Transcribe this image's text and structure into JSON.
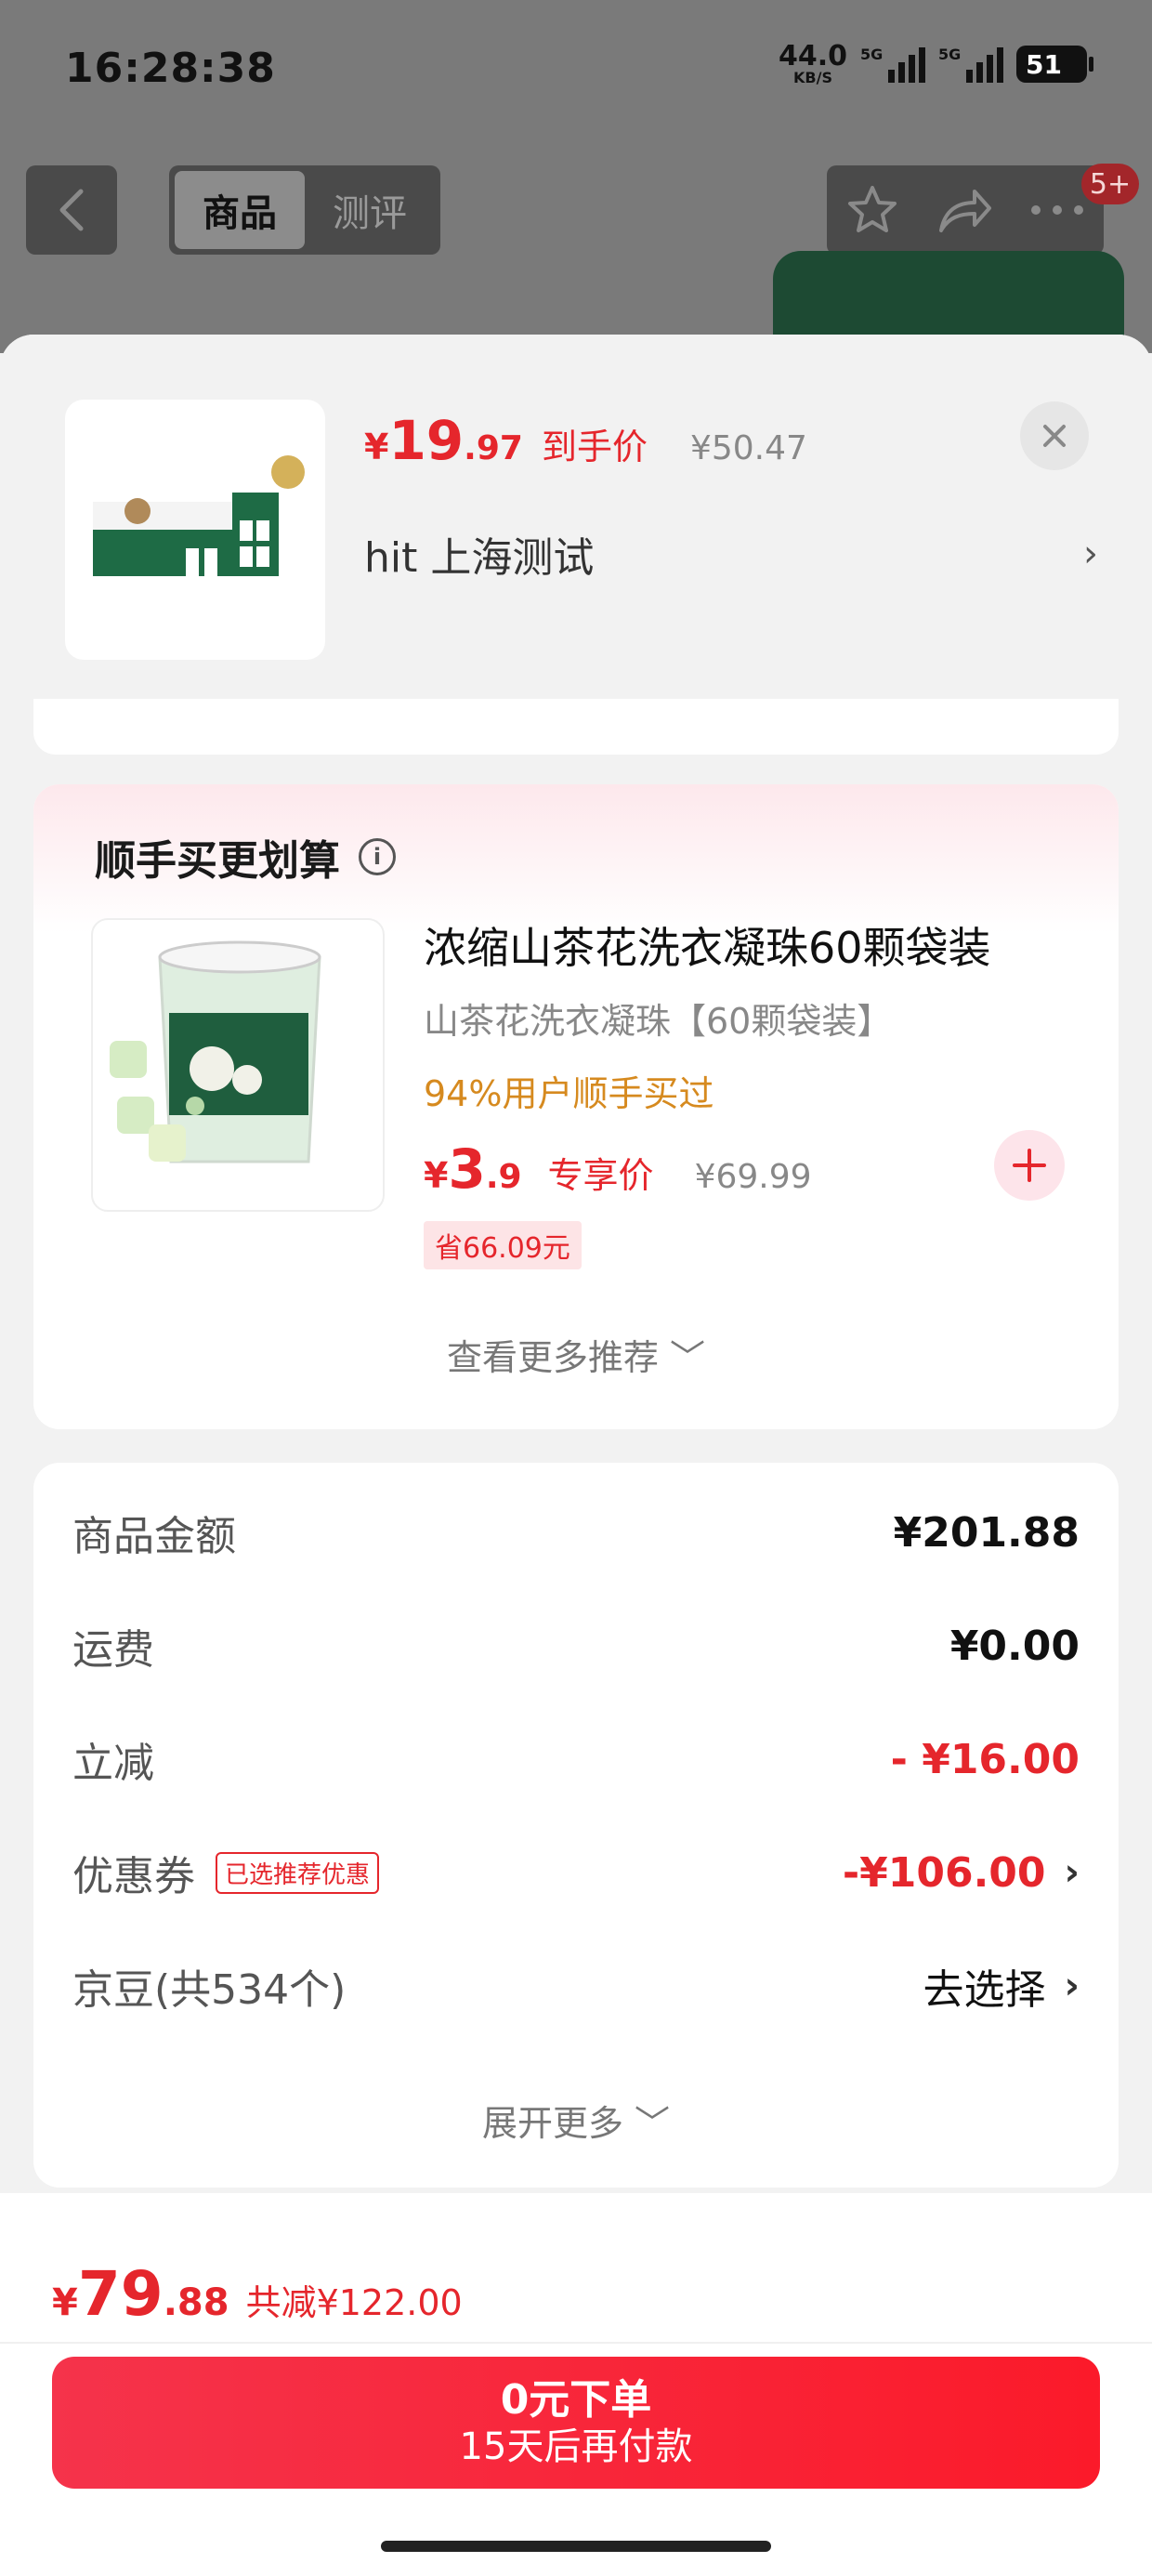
{
  "status_bar": {
    "time": "16:28:38",
    "net_speed_value": "44.0",
    "net_speed_unit": "KB/S",
    "signal1_label": "5G",
    "signal2_label": "5G",
    "battery": "51"
  },
  "nav": {
    "tab_product": "商品",
    "tab_review": "测评",
    "badge": "5+"
  },
  "sheet": {
    "price_symbol": "¥",
    "price_int": "19",
    "price_dec": ".97",
    "price_label": "到手价",
    "original_price": "¥50.47",
    "spec": "hit  上海测试",
    "spec_chevron": "›"
  },
  "recommend": {
    "title": "顺手买更划算",
    "product_name": "浓缩山茶花洗衣凝珠60颗袋装",
    "product_sub": "山茶花洗衣凝珠【60颗袋装】",
    "tip": "94%用户顺手买过",
    "price_symbol": "¥",
    "price_int": "3",
    "price_dec": ".9",
    "price_label": "专享价",
    "original_price": "¥69.99",
    "save_tag": "省66.09元",
    "more_label": "查看更多推荐 ﹀"
  },
  "summary": {
    "rows": [
      {
        "label": "商品金额",
        "value": "¥201.88"
      },
      {
        "label": "运费",
        "value": "¥0.00"
      },
      {
        "label": "立减",
        "value": "- ¥16.00"
      },
      {
        "label": "优惠券",
        "tag": "已选推荐优惠",
        "value": "-¥106.00",
        "chevron": "›"
      },
      {
        "label": "京豆(共534个)",
        "value": "去选择",
        "chevron": "›"
      }
    ],
    "expand_label": "展开更多 ﹀"
  },
  "footer": {
    "price_symbol": "¥",
    "price_int": "79",
    "price_dec": ".88",
    "saved": "共减¥122.00",
    "submit_main": "0元下单",
    "submit_sub": "15天后再付款"
  },
  "colors": {
    "accent_red": "#e5262c",
    "tip_orange": "#d68a1f",
    "promo_green": "#1d4a33"
  }
}
